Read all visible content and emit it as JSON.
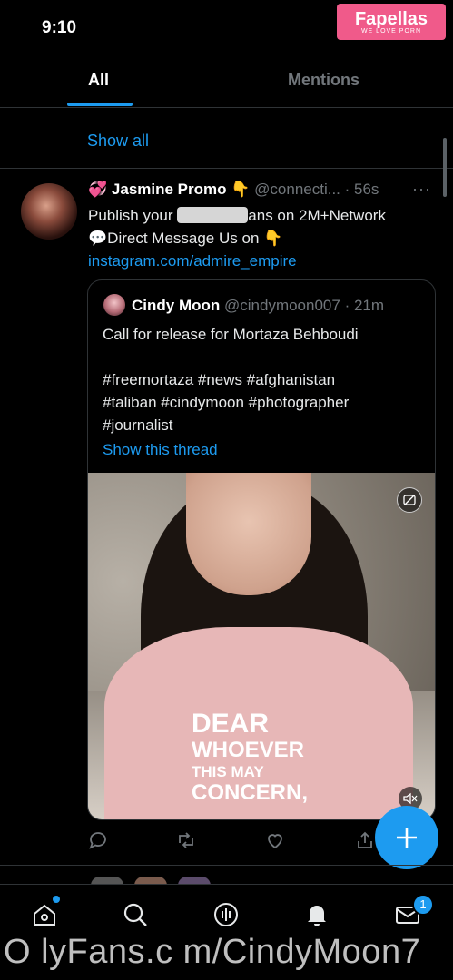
{
  "status": {
    "time": "9:10"
  },
  "watermark": {
    "title": "Fapellas",
    "subtitle": "WE LOVE PORN"
  },
  "tabs": [
    {
      "label": "All",
      "active": true
    },
    {
      "label": "Mentions",
      "active": false
    }
  ],
  "show_all": "Show all",
  "tweet": {
    "emoji": "💞",
    "name": "Jasmine Promo",
    "name_emoji": "👇",
    "handle": "@connecti...",
    "time": "· 56s",
    "more": "···",
    "line1a": "Publish your",
    "line1b": "ans on 2M+Network",
    "line2": "💬Direct Message Us on 👇",
    "link": "instagram.com/admire_empire"
  },
  "quote": {
    "name": "Cindy Moon",
    "handle": "@cindymoon007",
    "time": "· 21m",
    "text": "Call for release for Mortaza Behboudi\n\n#freemortaza #news #afghanistan\n#taliban #cindymoon #photographer\n#journalist",
    "show_thread": "Show this thread",
    "media_caption": [
      "DEAR",
      "WHOEVER",
      "THIS MAY",
      "CONCERN,"
    ]
  },
  "nav": {
    "messages_badge": "1"
  },
  "overlay_text": "O lyFans.c m/CindyMoon7",
  "colors": {
    "accent": "#1d9bf0",
    "background": "#000000",
    "muted": "#71767b"
  }
}
